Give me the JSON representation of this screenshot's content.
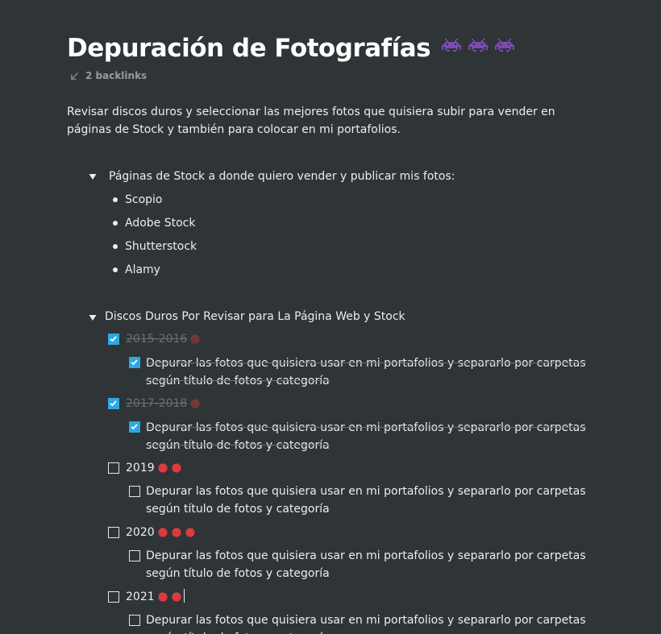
{
  "page": {
    "title": "Depuración de Fotografías",
    "title_icons": [
      "space-invader-icon",
      "space-invader-icon",
      "space-invader-icon"
    ],
    "backlinks_label": "2 backlinks",
    "description": "Revisar discos duros y seleccionar las mejores fotos que quisiera subir para vender en páginas de Stock y también para colocar en mi portafolios."
  },
  "stock_toggle": {
    "label": "Páginas de Stock a donde quiero vender y publicar mis fotos:",
    "items": [
      "Scopio",
      "Adobe Stock",
      "Shutterstock",
      "Alamy"
    ]
  },
  "disks_toggle": {
    "label": "Discos Duros Por Revisar para La Página Web y Stock",
    "tasks": [
      {
        "label": "2015-2016",
        "checked": true,
        "tomatoes": 1,
        "subtask": {
          "label": "Depurar las fotos que quisiera usar en mi portafolios y separarlo por carpetas según título de fotos y categoría",
          "checked": true
        }
      },
      {
        "label": "2017-2018",
        "checked": true,
        "tomatoes": 1,
        "subtask": {
          "label": "Depurar las fotos que quisiera usar en mi portafolios y separarlo por carpetas según título de fotos y categoría",
          "checked": true
        }
      },
      {
        "label": "2019",
        "checked": false,
        "tomatoes": 2,
        "subtask": {
          "label": "Depurar las fotos que quisiera usar en mi portafolios y separarlo por carpetas según título de fotos y categoría",
          "checked": false
        }
      },
      {
        "label": "2020",
        "checked": false,
        "tomatoes": 3,
        "subtask": {
          "label": "Depurar las fotos que quisiera usar en mi portafolios y separarlo por carpetas según título de fotos y categoría",
          "checked": false
        }
      },
      {
        "label": "2021",
        "checked": false,
        "tomatoes": 2,
        "subtask": {
          "label": "Depurar las fotos que quisiera usar en mi portafolios y separarlo por carpetas según título de fotos y categoría",
          "checked": false
        }
      }
    ]
  },
  "colors": {
    "background": "#2f3437",
    "text": "#ededed",
    "checkbox_checked": "#2ea8e0",
    "done_text": "#6b6f72",
    "invader": "#7b4bb0",
    "tomato": "#e0383e"
  }
}
